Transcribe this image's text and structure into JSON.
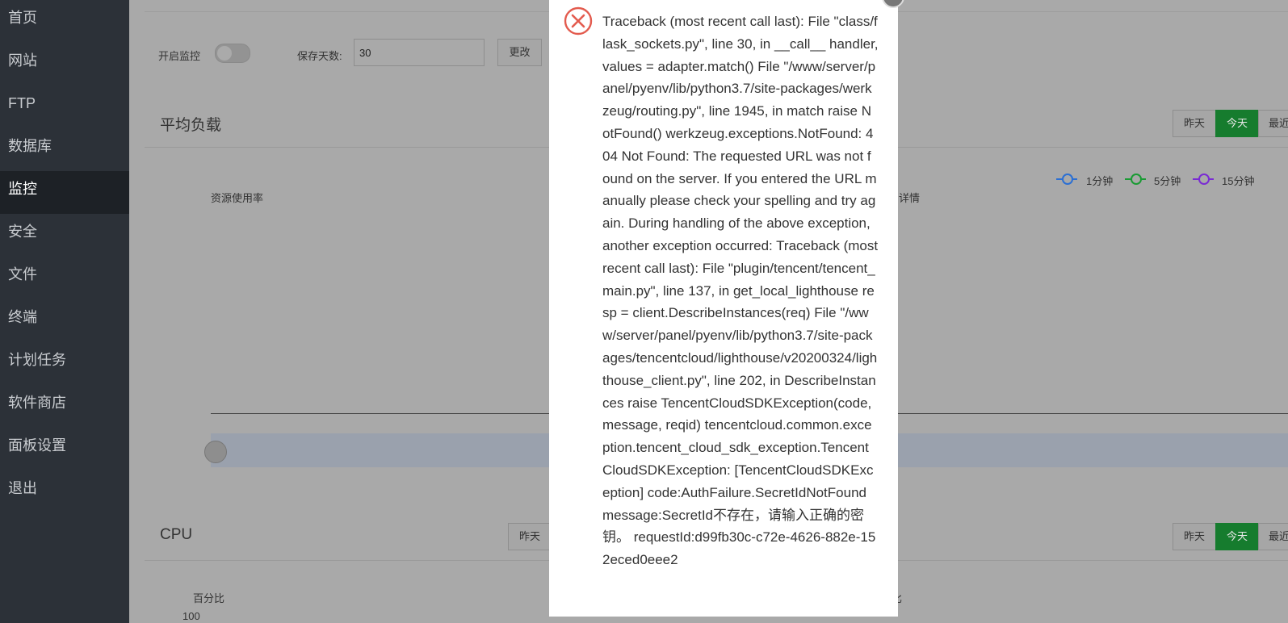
{
  "sidebar": {
    "items": [
      {
        "label": "首页"
      },
      {
        "label": "网站"
      },
      {
        "label": "FTP"
      },
      {
        "label": "数据库"
      },
      {
        "label": "监控",
        "active": true
      },
      {
        "label": "安全"
      },
      {
        "label": "文件"
      },
      {
        "label": "终端"
      },
      {
        "label": "计划任务"
      },
      {
        "label": "软件商店"
      },
      {
        "label": "面板设置"
      },
      {
        "label": "退出"
      }
    ]
  },
  "controls": {
    "monitor_label": "开启监控",
    "monitor_enabled": false,
    "retention_label": "保存天数:",
    "retention_value": "30",
    "change_button": "更改"
  },
  "load_section": {
    "title": "平均负载",
    "range_buttons": [
      "昨天",
      "今天",
      "最近"
    ],
    "selected": "今天",
    "left_caption": "资源使用率",
    "right_caption": "详情",
    "legend": [
      {
        "label": "1分钟",
        "color": "#2b6fd3"
      },
      {
        "label": "5分钟",
        "color": "#1a9b34"
      },
      {
        "label": "15分钟",
        "color": "#7a2bd3"
      }
    ]
  },
  "cpu_section": {
    "title": "CPU",
    "range_buttons_left": [
      "昨天"
    ],
    "range_buttons_right": [
      "昨天",
      "今天",
      "最近"
    ],
    "selected": "今天",
    "y_caption": "百分比",
    "y_caption_right": "比",
    "y_tick_top": "100"
  },
  "error_dialog": {
    "icon": "error-circle-x-icon",
    "message": "Traceback (most recent call last): File \"class/flask_sockets.py\", line 30, in __call__ handler, values = adapter.match() File \"/www/server/panel/pyenv/lib/python3.7/site-packages/werkzeug/routing.py\", line 1945, in match raise NotFound() werkzeug.exceptions.NotFound: 404 Not Found: The requested URL was not found on the server. If you entered the URL manually please check your spelling and try again. During handling of the above exception, another exception occurred: Traceback (most recent call last): File \"plugin/tencent/tencent_main.py\", line 137, in get_local_lighthouse resp = client.DescribeInstances(req) File \"/www/server/panel/pyenv/lib/python3.7/site-packages/tencentcloud/lighthouse/v20200324/lighthouse_client.py\", line 202, in DescribeInstances raise TencentCloudSDKException(code, message, reqid) tencentcloud.common.exception.tencent_cloud_sdk_exception.TencentCloudSDKException: [TencentCloudSDKException] code:AuthFailure.SecretIdNotFound message:SecretId不存在，请输入正确的密钥。 requestId:d99fb30c-c72e-4626-882e-152eced0eee2"
  }
}
